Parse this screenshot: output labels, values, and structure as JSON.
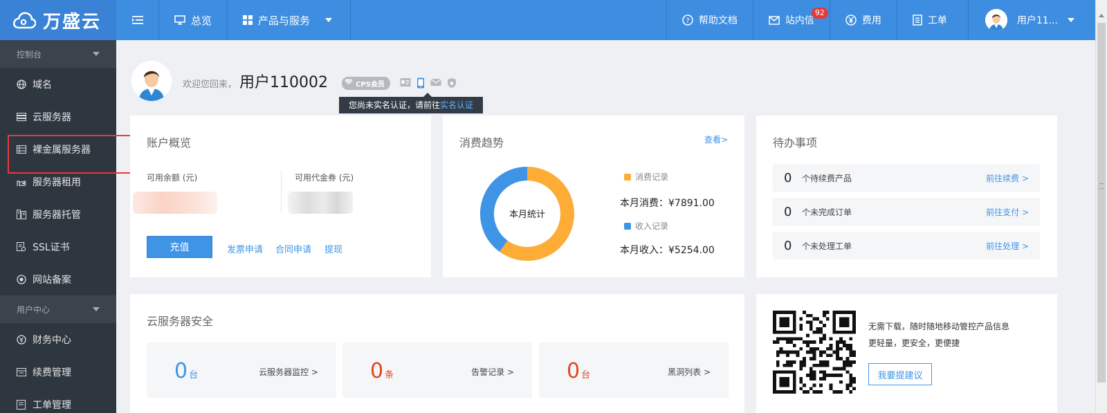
{
  "brand": {
    "name": "万盛云"
  },
  "topnav": {
    "overview": "总览",
    "products": "产品与服务",
    "help": "帮助文档",
    "messages": "站内信",
    "messages_badge": "92",
    "billing": "费用",
    "tickets": "工单",
    "user": "用户11..."
  },
  "sidebar": {
    "section1": "控制台",
    "items1": [
      "域名",
      "云服务器",
      "裸金属服务器",
      "服务器租用",
      "服务器托管",
      "SSL证书",
      "网站备案"
    ],
    "section2": "用户中心",
    "items2": [
      "财务中心",
      "续费管理",
      "工单管理"
    ]
  },
  "welcome": {
    "greeting": "欢迎您回来，",
    "username": "用户110002",
    "badge": "CPS会员",
    "tooltip_text": "您尚未实名认证，请前往",
    "tooltip_link": "实名认证"
  },
  "account": {
    "title": "账户概览",
    "balance_label": "可用余额 (元)",
    "voucher_label": "可用代金券 (元)",
    "recharge": "充值",
    "links": [
      "发票申请",
      "合同申请",
      "提现"
    ]
  },
  "trend": {
    "title": "消费趋势",
    "view": "查看>",
    "center": "本月统计",
    "legend_spend": "消费记录",
    "legend_income": "收入记录",
    "spend_label": "本月消费：¥7891.00",
    "income_label": "本月收入：¥5254.00",
    "spend_value": 7891.0,
    "income_value": 5254.0,
    "colors": {
      "spend": "#fdac36",
      "income": "#3f94e6"
    }
  },
  "todo": {
    "title": "待办事项",
    "rows": [
      {
        "num": "0",
        "desc": "个待续费产品",
        "go": "前往续费 >"
      },
      {
        "num": "0",
        "desc": "个未完成订单",
        "go": "前往支付 >"
      },
      {
        "num": "0",
        "desc": "个未处理工单",
        "go": "前往处理 >"
      }
    ]
  },
  "security": {
    "title": "云服务器安全",
    "boxes": [
      {
        "num": "0",
        "unit": "台",
        "label": "云服务器监控 >",
        "color": "#3f94e6"
      },
      {
        "num": "0",
        "unit": "条",
        "label": "告警记录 >",
        "color": "#e4461e"
      },
      {
        "num": "0",
        "unit": "台",
        "label": "黑洞列表 >",
        "color": "#e4461e"
      }
    ]
  },
  "app": {
    "line1": "无需下载，随时随地移动管控产品信息",
    "line2": "更轻量，更安全，更便捷",
    "button": "我要提建议"
  }
}
